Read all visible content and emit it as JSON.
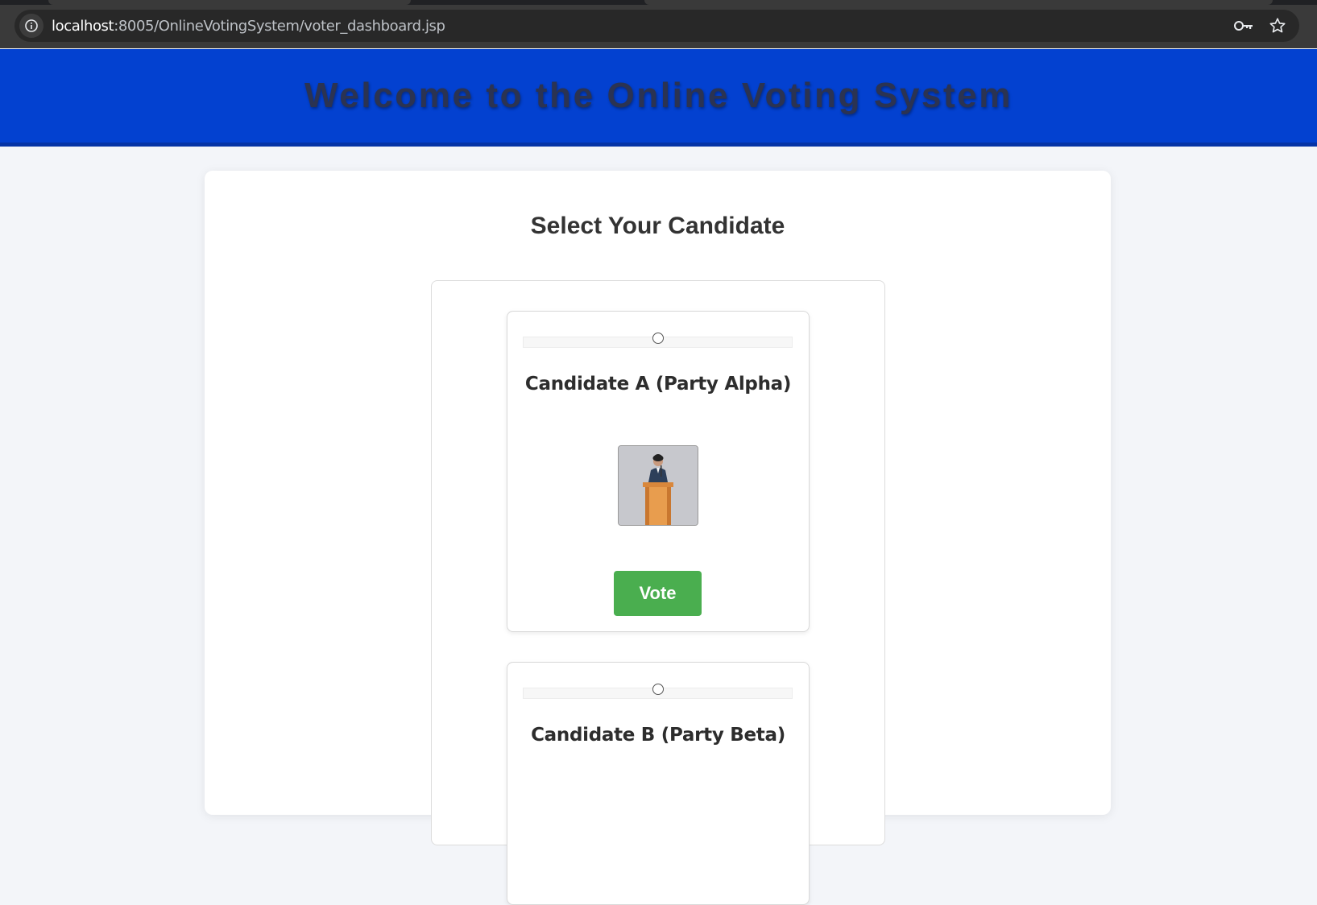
{
  "browser": {
    "url_host": "localhost",
    "url_path": ":8005/OnlineVotingSystem/voter_dashboard.jsp",
    "icons": [
      "info-icon",
      "key-icon",
      "star-icon"
    ]
  },
  "header": {
    "title": "Welcome to the Online Voting System",
    "background_color": "#0341d0"
  },
  "main": {
    "section_title": "Select Your Candidate",
    "candidates": [
      {
        "name": "Candidate A (Party Alpha)",
        "photo_icon": "candidate-at-podium-icon",
        "vote_label": "Vote",
        "selected": false
      },
      {
        "name": "Candidate B (Party Beta)",
        "selected": false
      }
    ],
    "vote_button_color": "#4aae4f"
  }
}
